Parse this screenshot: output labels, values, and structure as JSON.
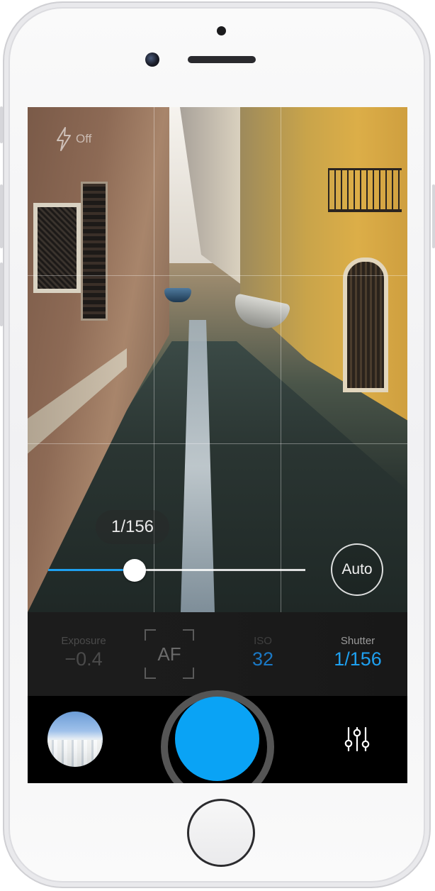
{
  "viewfinder": {
    "flash": {
      "icon": "flash-off-icon",
      "label": "Off"
    },
    "slider": {
      "value_label": "1/156",
      "fill_fraction": 0.34
    },
    "auto_button": "Auto"
  },
  "settings": {
    "exposure": {
      "label": "Exposure",
      "value": "−0.4"
    },
    "focus": {
      "label": "AF"
    },
    "iso": {
      "label": "ISO",
      "value": "32"
    },
    "shutter": {
      "label": "Shutter",
      "value": "1/156"
    }
  },
  "bottom": {
    "gallery_thumbnail": "gallery-thumbnail",
    "shutter_button": "shutter-button",
    "settings_icon": "sliders-icon"
  },
  "colors": {
    "accent": "#1ea0f0",
    "shutter": "#0aa3f5",
    "iso_value": "#1b78c4"
  }
}
